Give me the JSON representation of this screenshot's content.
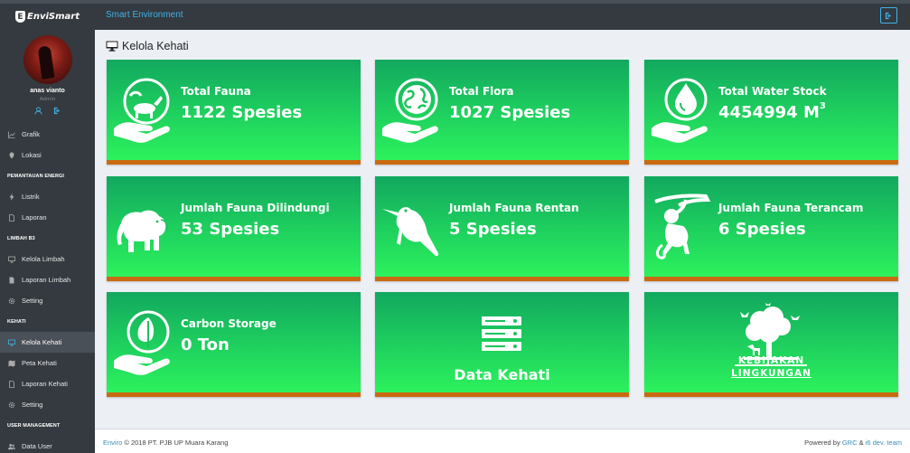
{
  "topbar": {
    "logo_text": "EnviSmart",
    "logo_mark": "E",
    "app_title": "Smart Environment"
  },
  "user": {
    "name": "anas vianto",
    "role": "Admin"
  },
  "sidebar": {
    "items": [
      {
        "type": "item",
        "label": "Grafik",
        "icon": "chart-icon"
      },
      {
        "type": "item",
        "label": "Lokasi",
        "icon": "location-icon"
      },
      {
        "type": "header",
        "label": "PEMANTAUAN ENERGI"
      },
      {
        "type": "item",
        "label": "Listrik",
        "icon": "bolt-icon"
      },
      {
        "type": "item",
        "label": "Laporan",
        "icon": "file-icon"
      },
      {
        "type": "header",
        "label": "LIMBAH B3"
      },
      {
        "type": "item",
        "label": "Kelola Limbah",
        "icon": "monitor-icon"
      },
      {
        "type": "item",
        "label": "Laporan Limbah",
        "icon": "file-icon"
      },
      {
        "type": "item",
        "label": "Setting",
        "icon": "gear-icon"
      },
      {
        "type": "header",
        "label": "KEHATI"
      },
      {
        "type": "item",
        "label": "Kelola Kehati",
        "icon": "monitor-icon",
        "active": true
      },
      {
        "type": "item",
        "label": "Peta Kehati",
        "icon": "map-icon"
      },
      {
        "type": "item",
        "label": "Laporan Kehati",
        "icon": "file-icon"
      },
      {
        "type": "item",
        "label": "Setting",
        "icon": "gear-icon"
      },
      {
        "type": "header",
        "label": "USER MANAGEMENT"
      },
      {
        "type": "item",
        "label": "Data User",
        "icon": "users-icon"
      }
    ]
  },
  "page": {
    "title": "Kelola Kehati"
  },
  "cards": [
    {
      "title": "Total Fauna",
      "value": "1122 Spesies",
      "icon": "fauna-globe-hand-icon"
    },
    {
      "title": "Total Flora",
      "value": "1027 Spesies",
      "icon": "earth-hand-icon"
    },
    {
      "title": "Total Water Stock",
      "value": "4454994 M",
      "value_sup": "3",
      "icon": "water-drop-hand-icon"
    },
    {
      "title": "Jumlah Fauna Dilindungi",
      "value": "53 Spesies",
      "icon": "elephant-icon"
    },
    {
      "title": "Jumlah Fauna Rentan",
      "value": "5 Spesies",
      "icon": "kingfisher-icon"
    },
    {
      "title": "Jumlah Fauna Terancam",
      "value": "6 Spesies",
      "icon": "monkey-icon"
    },
    {
      "title": "Carbon Storage",
      "value": "0 Ton",
      "icon": "leaf-hand-icon"
    },
    {
      "title": "Data Kehati",
      "icon": "server-icon"
    },
    {
      "title": "KEBIJAKAN LINGKUNGAN",
      "icon": "tree-birds-icon"
    }
  ],
  "kebijakan": {
    "line1": "KEBIJAKAN",
    "line2": "LINGKUNGAN"
  },
  "footer": {
    "brand_link": "Enviro",
    "copyright": "© 2018 PT. PJB UP Muara Karang",
    "powered_by": "Powered by",
    "link1": "GRC",
    "amp": "&",
    "link2": "i6 dev. team"
  },
  "colors": {
    "topbar": "#343a40",
    "accent": "#3fb2e6",
    "card_top": "#12a85f",
    "card_bottom": "#2cf25c",
    "card_border": "#c96a12"
  }
}
